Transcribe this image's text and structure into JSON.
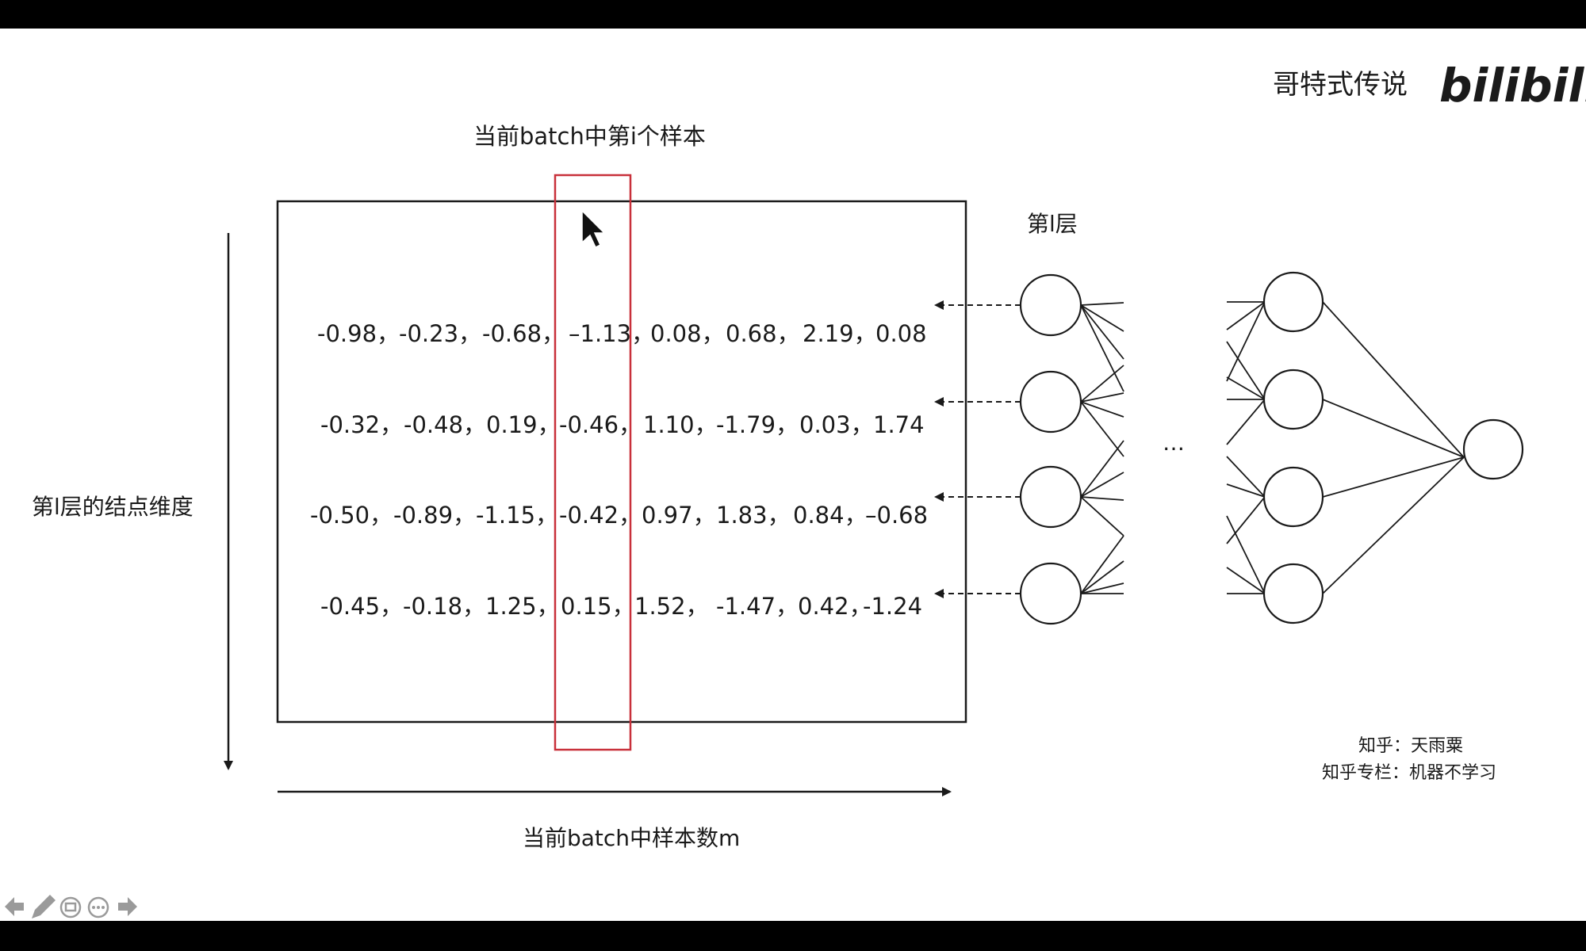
{
  "highlight_label": "当前batch中第i个样本",
  "layer_label": "第l层",
  "y_axis_label": "第l层的结点维度",
  "x_axis_label": "当前batch中样本数m",
  "ellipsis": "…",
  "watermark": {
    "text": "哥特式传说",
    "brand": "bilibili"
  },
  "credits": {
    "line1": "知乎：天雨粟",
    "line2": "知乎专栏：机器不学习"
  },
  "matrix": {
    "rows": [
      [
        "-0.98，",
        "-0.23，",
        "-0.68，",
        "–1.13，",
        "0.08，",
        "0.68，",
        "2.19，",
        "0.08"
      ],
      [
        "-0.32，",
        "-0.48，",
        "0.19，",
        "-0.46，",
        "1.10，",
        "-1.79，",
        "0.03，",
        "1.74"
      ],
      [
        "-0.50，",
        "-0.89，",
        "-1.15，",
        "-0.42，",
        "0.97，",
        "1.83，",
        "0.84，",
        "–0.68"
      ],
      [
        "-0.45，",
        "-0.18，",
        "1.25，",
        "0.15，",
        "1.52，",
        "-1.47，",
        "0.42，",
        "-1.24"
      ]
    ]
  },
  "colors": {
    "highlight": "#c8303a",
    "ink": "#1a1a1a",
    "background": "#ffffff",
    "letterbox": "#000000"
  },
  "toolbar_icons": [
    "arrow-left-icon",
    "pen-icon",
    "slides-icon",
    "more-icon",
    "arrow-right-icon"
  ]
}
